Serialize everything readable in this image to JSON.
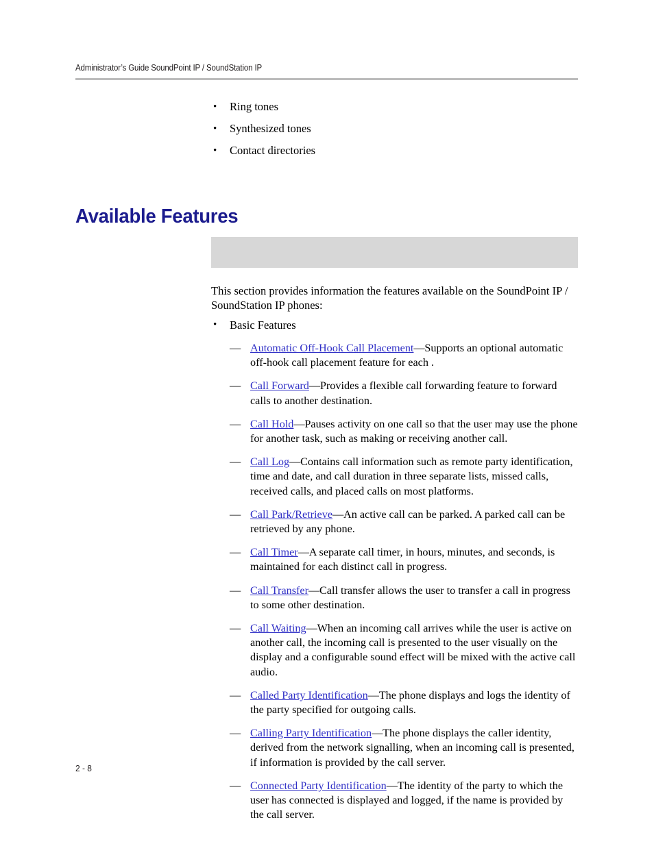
{
  "header": {
    "running_title": "Administrator’s Guide SoundPoint IP / SoundStation IP"
  },
  "footer": {
    "page_number": "2 - 8"
  },
  "colors": {
    "heading": "#1c1c8e",
    "cross_reference": "#2f2fc6",
    "rule": "#bcbcbc",
    "placeholder_block": "#d7d7d7",
    "body_text": "#000000"
  },
  "top_list": {
    "items": [
      "Ring tones",
      "Synthesized tones",
      "Contact directories"
    ],
    "bullet_glyph": "•"
  },
  "section": {
    "heading": "Available Features",
    "intro": "This section provides information the features available on the SoundPoint IP / SoundStation IP phones:"
  },
  "feature_list": {
    "bullet_glyph": "•",
    "dash_glyph": "—",
    "separator": "—",
    "category": "Basic Features",
    "items": [
      {
        "link": "Automatic Off-Hook Call Placement",
        "description": "Supports an optional automatic off-hook call placement feature for each ."
      },
      {
        "link": "Call Forward",
        "description": "Provides a flexible call forwarding feature to forward calls to another destination."
      },
      {
        "link": "Call Hold",
        "description": "Pauses activity on one call so that the user may use the phone for another task, such as making or receiving another call."
      },
      {
        "link": "Call Log",
        "description": "Contains call information such as remote party identification, time and date, and call duration in three separate lists, missed calls, received calls, and placed calls on most platforms."
      },
      {
        "link": "Call Park/Retrieve",
        "description": "An active call can be parked. A parked call can be retrieved by any phone."
      },
      {
        "link": "Call Timer",
        "description": "A separate call timer, in hours, minutes, and seconds, is maintained for each distinct call in progress."
      },
      {
        "link": "Call Transfer",
        "description": "Call transfer allows the user to transfer a call in progress to some other destination."
      },
      {
        "link": "Call Waiting",
        "description": "When an incoming call arrives while the user is active on another call, the incoming call is presented to the user visually on the display and a configurable sound effect will be mixed with the active call audio."
      },
      {
        "link": "Called Party Identification",
        "description": "The phone displays and logs the identity of the party specified for outgoing calls."
      },
      {
        "link": "Calling Party Identification",
        "description": "The phone displays the caller identity, derived from the network signalling, when an incoming call is presented, if information is provided by the call server."
      },
      {
        "link": "Connected Party Identification",
        "description": "The identity of the party to which the user has connected is displayed and logged, if the name is provided by the call server."
      }
    ]
  }
}
